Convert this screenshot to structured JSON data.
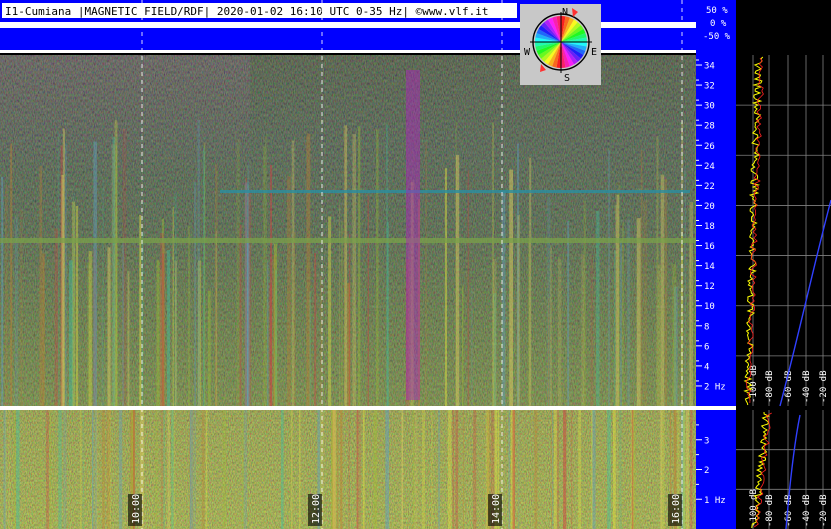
{
  "header": {
    "title": "I1-Cumiana |MAGNETIC FIELD/RDF| 2020-01-02 16:10 UTC 0-35 Hz| ©www.vlf.it",
    "rdf_scale": [
      "50 %",
      "0 %",
      "-50 %"
    ]
  },
  "compass": {
    "n": "N",
    "e": "E",
    "s": "S",
    "w": "W"
  },
  "colors": {
    "header_blue": "#0000ff",
    "background": "#000000",
    "grid": "#ffffff",
    "trace_yellow": "#ffff00",
    "trace_red": "#ff0000",
    "trace_blue": "#3040ff"
  },
  "chart_data": [
    {
      "type": "heatmap",
      "name": "spectrogram-main",
      "x": [
        "10:00",
        "12:00",
        "14:00",
        "16:00"
      ],
      "ylim": [
        0,
        35
      ],
      "yticks": [
        {
          "value": 2,
          "label": "2 Hz"
        },
        {
          "value": 4,
          "label": "4"
        },
        {
          "value": 6,
          "label": "6"
        },
        {
          "value": 8,
          "label": "8"
        },
        {
          "value": 10,
          "label": "10"
        },
        {
          "value": 12,
          "label": "12"
        },
        {
          "value": 14,
          "label": "14"
        },
        {
          "value": 16,
          "label": "16"
        },
        {
          "value": 18,
          "label": "18"
        },
        {
          "value": 20,
          "label": "20"
        },
        {
          "value": 22,
          "label": "22"
        },
        {
          "value": 24,
          "label": "24"
        },
        {
          "value": 26,
          "label": "26"
        },
        {
          "value": 28,
          "label": "28"
        },
        {
          "value": 30,
          "label": "30"
        },
        {
          "value": 32,
          "label": "32"
        },
        {
          "value": 34,
          "label": "34"
        }
      ]
    },
    {
      "type": "heatmap",
      "name": "spectrogram-zoom",
      "x": [
        "10:00",
        "12:00",
        "14:00",
        "16:00"
      ],
      "ylim": [
        0,
        4
      ],
      "yticks": [
        {
          "value": 1,
          "label": "1 Hz"
        },
        {
          "value": 2,
          "label": "2"
        },
        {
          "value": 3,
          "label": "3"
        }
      ]
    },
    {
      "type": "line",
      "name": "spectrum-main",
      "x_labels": [
        "-100 dB",
        "-80 dB",
        "-60 dB",
        "-40 dB",
        "-20 dB"
      ]
    },
    {
      "type": "line",
      "name": "spectrum-zoom",
      "x_labels": [
        "-100 dB",
        "-80 dB",
        "-60 dB",
        "-40 dB",
        "-20 dB"
      ]
    }
  ]
}
